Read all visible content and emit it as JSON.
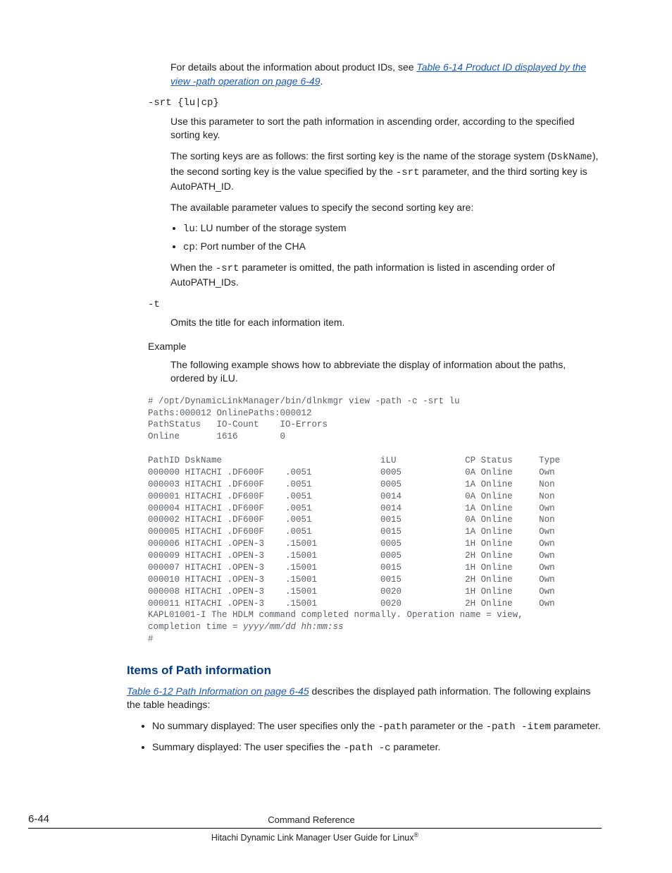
{
  "intro": {
    "prefix": "For details about the information about product IDs, see ",
    "link": "Table 6-14 Product ID displayed by the view -path operation on page 6-49",
    "suffix": "."
  },
  "srt": {
    "term": "-srt {lu|cp}",
    "p1": "Use this parameter to sort the path information in ascending order, according to the specified sorting key.",
    "p2a": "The sorting keys are as follows: the first sorting key is the name of the storage system (",
    "p2code": "DskName",
    "p2b": "), the second sorting key is the value specified by the ",
    "p2code2": "-srt",
    "p2c": " parameter, and the third sorting key is AutoPATH_ID.",
    "p3": "The available parameter values to specify the second sorting key are:",
    "b1code": "lu",
    "b1text": ": LU number of the storage system",
    "b2code": "cp",
    "b2text": ": Port number of the CHA",
    "p4a": "When the ",
    "p4code": "-srt",
    "p4b": " parameter is omitted, the path information is listed in ascending order of AutoPATH_IDs."
  },
  "t": {
    "term": "-t",
    "p1": "Omits the title for each information item."
  },
  "example": {
    "label": "Example",
    "desc": "The following example shows how to abbreviate the display of information about the paths, ordered by iLU."
  },
  "code": {
    "l1": "# /opt/DynamicLinkManager/bin/dlnkmgr view -path -c -srt lu",
    "l2": "Paths:000012 OnlinePaths:000012",
    "l3": "PathStatus   IO-Count    IO-Errors",
    "l4": "Online       1616        0",
    "l5": "",
    "l6": "PathID DskName                              iLU             CP Status     Type",
    "l7": "000000 HITACHI .DF600F    .0051             0005            0A Online     Own",
    "l8": "000003 HITACHI .DF600F    .0051             0005            1A Online     Non",
    "l9": "000001 HITACHI .DF600F    .0051             0014            0A Online     Non",
    "l10": "000004 HITACHI .DF600F    .0051             0014            1A Online     Own",
    "l11": "000002 HITACHI .DF600F    .0051             0015            0A Online     Non",
    "l12": "000005 HITACHI .DF600F    .0051             0015            1A Online     Own",
    "l13": "000006 HITACHI .OPEN-3    .15001            0005            1H Online     Own",
    "l14": "000009 HITACHI .OPEN-3    .15001            0005            2H Online     Own",
    "l15": "000007 HITACHI .OPEN-3    .15001            0015            1H Online     Own",
    "l16": "000010 HITACHI .OPEN-3    .15001            0015            2H Online     Own",
    "l17": "000008 HITACHI .OPEN-3    .15001            0020            1H Online     Own",
    "l18": "000011 HITACHI .OPEN-3    .15001            0020            2H Online     Own",
    "l19": "KAPL01001-I The HDLM command completed normally. Operation name = view,",
    "l20a": "completion time = ",
    "l20b": "yyyy/mm/dd hh:mm:ss",
    "l21": "#"
  },
  "items": {
    "heading": "Items of Path information",
    "link": "Table 6-12 Path Information on page 6-45",
    "p1b": " describes the displayed path information. The following explains the table headings:",
    "b1a": "No summary displayed: The user specifies only the ",
    "b1code1": "-path",
    "b1b": " parameter or the ",
    "b1code2": "-path -item",
    "b1c": " parameter.",
    "b2a": "Summary displayed: The user specifies the ",
    "b2code": "-path -c",
    "b2b": " parameter."
  },
  "footer": {
    "pagenum": "6-44",
    "chapter": "Command Reference",
    "book": "Hitachi Dynamic Link Manager User Guide for Linux"
  }
}
